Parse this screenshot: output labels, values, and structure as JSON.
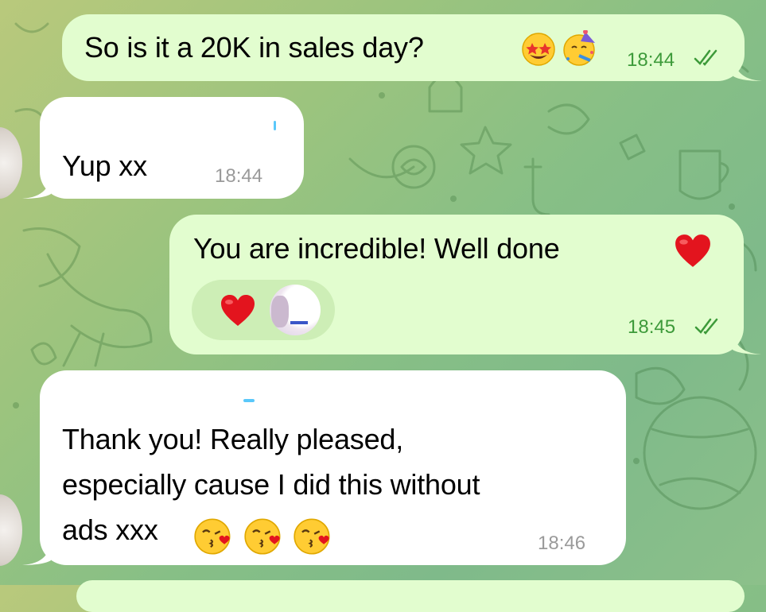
{
  "chat": {
    "messages": [
      {
        "id": "m1",
        "direction": "outgoing",
        "text": "So is it a 20K in sales day?",
        "emojis": [
          "star-struck-emoji",
          "partying-face-emoji"
        ],
        "time": "18:44",
        "status": "read"
      },
      {
        "id": "m2",
        "direction": "incoming",
        "text": "Yup xx",
        "time": "18:44"
      },
      {
        "id": "m3",
        "direction": "outgoing",
        "text": "You are incredible! Well done",
        "emojis": [
          "red-heart-emoji"
        ],
        "reaction": "red-heart-emoji",
        "time": "18:45",
        "status": "read"
      },
      {
        "id": "m4",
        "direction": "incoming",
        "text_lines": [
          "Thank you! Really pleased,",
          "especially cause I did this without",
          "ads xxx"
        ],
        "emojis": [
          "face-blowing-kiss-emoji",
          "face-blowing-kiss-emoji",
          "face-blowing-kiss-emoji"
        ],
        "time": "18:46"
      }
    ]
  },
  "colors": {
    "outgoing_bubble": "#e2fdcf",
    "incoming_bubble": "#ffffff",
    "outgoing_time": "#3d9a3a",
    "incoming_time": "#9a9a9a",
    "heart": "#e3141e"
  }
}
